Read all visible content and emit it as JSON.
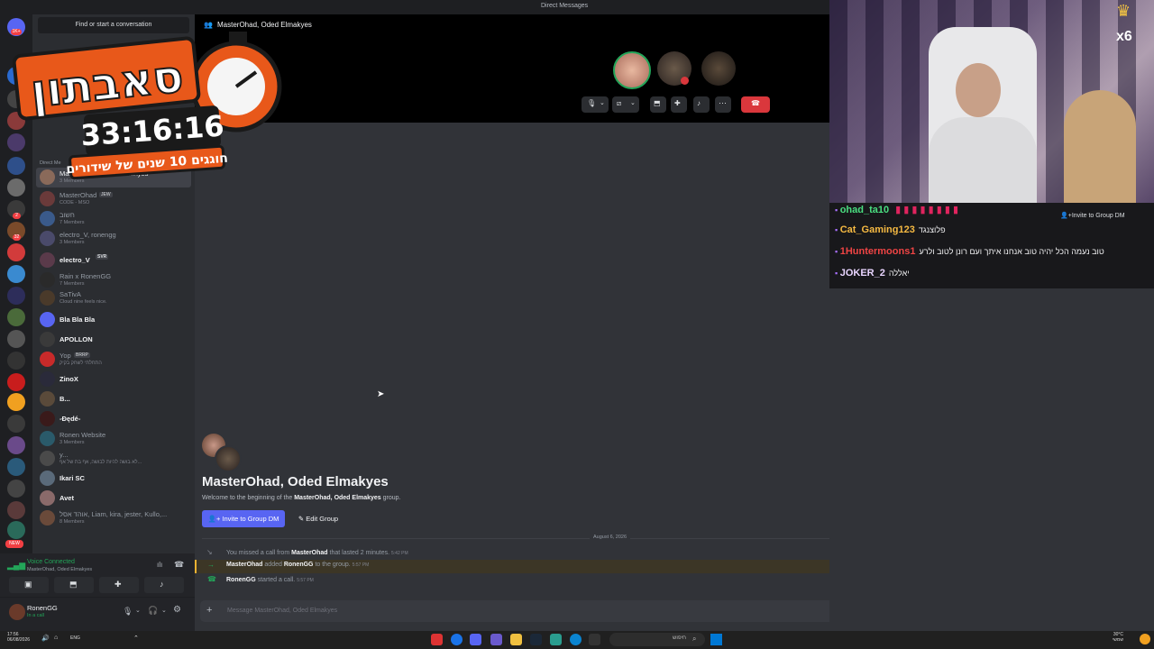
{
  "window": {
    "title": "Direct Messages"
  },
  "overlay": {
    "logo_text": "סאבתון",
    "timer": "33:16:16",
    "subtitle": "חוגגים 10 שנים של שידורים"
  },
  "sidebar": {
    "search_placeholder": "Find or start a conversation",
    "section_label": "Direct Me",
    "dms": [
      {
        "name": "MasterOhad, Oded Elmakyes",
        "sub": "3 Members",
        "active": true
      },
      {
        "name": "MasterOhad",
        "tag": "JEW",
        "sub": "CODE - MSO"
      },
      {
        "name": "חשוב",
        "sub": "7 Members"
      },
      {
        "name": "electro_V, ronengg",
        "sub": "3 Members"
      },
      {
        "name": "electro_V",
        "tag": "SVR"
      },
      {
        "name": "Rain x RonenGG",
        "sub": "7 Members"
      },
      {
        "name": "SaTivA",
        "sub": "Cloud nine feels nice."
      },
      {
        "name": "Bla Bla Bla"
      },
      {
        "name": "APOLLON"
      },
      {
        "name": "Yop",
        "tag": "BRRP",
        "sub": "התחלתי לשחק בקיק"
      },
      {
        "name": "ZinoX"
      },
      {
        "name": "B..."
      },
      {
        "name": "-Ðędé-"
      },
      {
        "name": "Ronen Website",
        "sub": "3 Members"
      },
      {
        "name": "y...",
        "sub": "לא בושה להיות לבושה, אף בת של אף..."
      },
      {
        "name": "Ikari SC"
      },
      {
        "name": "Avet"
      },
      {
        "name": "אוהד אסל, Liam, kira, jester, Kullo,...",
        "sub": "8 Members"
      }
    ],
    "rail_badges": [
      "1K+",
      "2",
      "32",
      "19",
      "NEW"
    ]
  },
  "voice": {
    "status": "Voice Connected",
    "channel": "MasterOhad, Oded Elmakyes"
  },
  "user": {
    "name": "RonenGG",
    "status": "In a call"
  },
  "call": {
    "header_title": "MasterOhad, Oded Elmakyes"
  },
  "chat": {
    "group_title": "MasterOhad, Oded Elmakyes",
    "welcome_prefix": "Welcome to the beginning of the ",
    "welcome_name": "MasterOhad, Oded Elmakyes",
    "welcome_suffix": " group.",
    "invite_button": "Invite to Group DM",
    "edit_button": "Edit Group",
    "date_divider": "August 6, 2026",
    "messages": [
      {
        "pre": "You missed a call from ",
        "who": "MasterOhad",
        "post": " that lasted 2 minutes.",
        "time": "5:42 PM"
      },
      {
        "pre": "",
        "who": "MasterOhad",
        "post": " added ",
        "who2": "RonenGG",
        "post2": " to the group.",
        "time": "5:57 PM"
      },
      {
        "pre": "",
        "who": "RonenGG",
        "post": " started a call.",
        "time": "5:57 PM"
      }
    ],
    "composer_placeholder": "Message MasterOhad, Oded Elmakyes"
  },
  "stream": {
    "multiplier": "x6",
    "invite_label": "Invite to Group DM",
    "chat": [
      {
        "user": "ohad_ta10",
        "msg": "",
        "color": "#4ade80"
      },
      {
        "user": "Cat_Gaming123",
        "msg": "פלוצנגד",
        "color": "#f5b942"
      },
      {
        "user": "1Huntermoons1",
        "msg": "טוב נעמה הכל יהיה טוב אנחנו איתך ועם רונן לטוב ולרע",
        "color": "#ef4444"
      },
      {
        "user": "JOKER_2",
        "msg": "יאללה",
        "color": "#e9d5ff"
      }
    ]
  },
  "taskbar": {
    "time": "17:56",
    "date": "06/08/2026",
    "search": "חיפוש",
    "weather": "30°C",
    "weather_note": "שמשי"
  },
  "colors": {
    "accent": "#5865f2",
    "danger": "#da373c",
    "green": "#23a559"
  }
}
